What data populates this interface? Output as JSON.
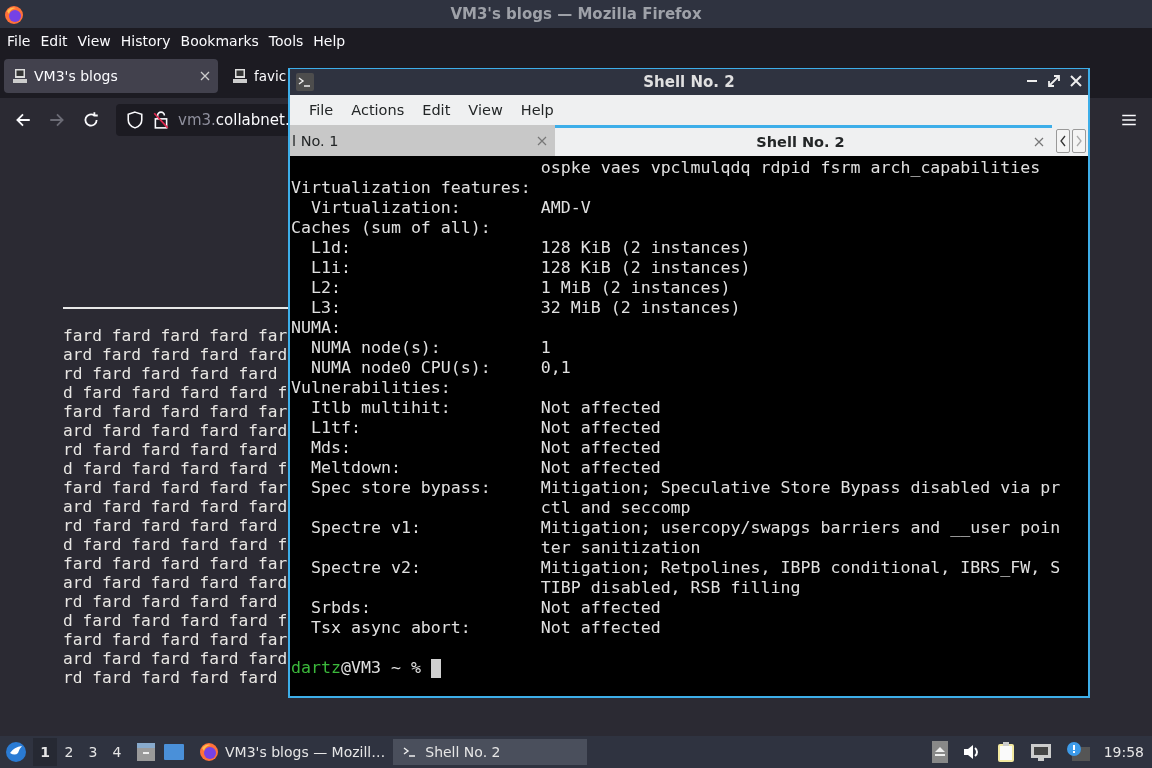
{
  "firefox": {
    "title": "VM3's blogs — Mozilla Firefox",
    "menu": [
      "File",
      "Edit",
      "View",
      "History",
      "Bookmarks",
      "Tools",
      "Help"
    ],
    "tabs": [
      {
        "label": "VM3's blogs",
        "selected": true
      },
      {
        "label": "favic",
        "selected": false
      }
    ],
    "url": [
      {
        "text": "vm3.",
        "dim": true
      },
      {
        "text": "collabnet.",
        "dim": false
      }
    ],
    "page_lines": [
      "fard fard fard fard far",
      "ard fard fard fard fard",
      "rd fard fard fard fard",
      "d fard fard fard fard f",
      "fard fard fard fard far",
      "ard fard fard fard fard",
      "rd fard fard fard fard",
      "d fard fard fard fard f",
      "fard fard fard fard far",
      "ard fard fard fard fard",
      "rd fard fard fard fard",
      "d fard fard fard fard f",
      "fard fard fard fard far",
      "ard fard fard fard fard",
      "rd fard fard fard fard",
      "d fard fard fard fard f",
      "fard fard fard fard far",
      "ard fard fard fard fard",
      "rd fard fard fard fard"
    ]
  },
  "terminal": {
    "title": "Shell No. 2",
    "menu": [
      "File",
      "Actions",
      "Edit",
      "View",
      "Help"
    ],
    "tabs": [
      {
        "label": "l No. 1",
        "selected": false
      },
      {
        "label": "Shell No. 2",
        "selected": true
      }
    ],
    "rows": [
      {
        "value": "ospke vaes vpclmulqdq rdpid fsrm arch_capabilities"
      },
      {
        "label": "Virtualization features:"
      },
      {
        "label": "  Virtualization:",
        "value": "AMD-V"
      },
      {
        "label": "Caches (sum of all):"
      },
      {
        "label": "  L1d:",
        "value": "128 KiB (2 instances)"
      },
      {
        "label": "  L1i:",
        "value": "128 KiB (2 instances)"
      },
      {
        "label": "  L2:",
        "value": "1 MiB (2 instances)"
      },
      {
        "label": "  L3:",
        "value": "32 MiB (2 instances)"
      },
      {
        "label": "NUMA:"
      },
      {
        "label": "  NUMA node(s):",
        "value": "1"
      },
      {
        "label": "  NUMA node0 CPU(s):",
        "value": "0,1"
      },
      {
        "label": "Vulnerabilities:"
      },
      {
        "label": "  Itlb multihit:",
        "value": "Not affected"
      },
      {
        "label": "  L1tf:",
        "value": "Not affected"
      },
      {
        "label": "  Mds:",
        "value": "Not affected"
      },
      {
        "label": "  Meltdown:",
        "value": "Not affected"
      },
      {
        "label": "  Spec store bypass:",
        "value": "Mitigation; Speculative Store Bypass disabled via pr"
      },
      {
        "value": "ctl and seccomp"
      },
      {
        "label": "  Spectre v1:",
        "value": "Mitigation; usercopy/swapgs barriers and __user poin"
      },
      {
        "value": "ter sanitization"
      },
      {
        "label": "  Spectre v2:",
        "value": "Mitigation; Retpolines, IBPB conditional, IBRS_FW, S"
      },
      {
        "value": "TIBP disabled, RSB filling"
      },
      {
        "label": "  Srbds:",
        "value": "Not affected"
      },
      {
        "label": "  Tsx async abort:",
        "value": "Not affected"
      }
    ],
    "prompt": {
      "user": "dartz",
      "rest": "@VM3 ~ %"
    }
  },
  "taskbar": {
    "workspaces": [
      {
        "label": "1",
        "selected": true
      },
      {
        "label": "2",
        "selected": false
      },
      {
        "label": "3",
        "selected": false
      },
      {
        "label": "4",
        "selected": false
      }
    ],
    "tasks": [
      {
        "kind": "browser",
        "label": "VM3's blogs — Mozill…",
        "selected": false
      },
      {
        "kind": "terminal",
        "label": "Shell No. 2",
        "selected": true
      }
    ],
    "clock": "19:58"
  }
}
